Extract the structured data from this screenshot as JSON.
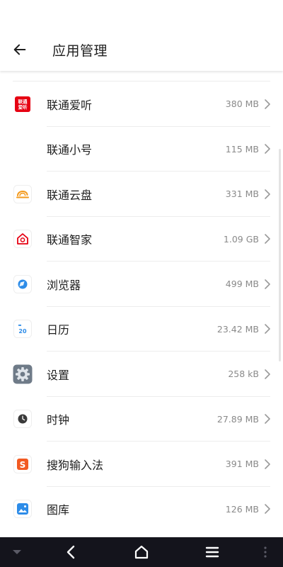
{
  "header": {
    "title": "应用管理"
  },
  "apps": [
    {
      "name": "联通爱听",
      "size": "380 MB",
      "icon": "unicom-aiting-icon"
    },
    {
      "name": "联通小号",
      "size": "115 MB",
      "icon": "none"
    },
    {
      "name": "联通云盘",
      "size": "331 MB",
      "icon": "unicom-cloud-icon"
    },
    {
      "name": "联通智家",
      "size": "1.09 GB",
      "icon": "unicom-smarthome-icon"
    },
    {
      "name": "浏览器",
      "size": "499 MB",
      "icon": "browser-icon"
    },
    {
      "name": "日历",
      "size": "23.42 MB",
      "icon": "calendar-icon"
    },
    {
      "name": "设置",
      "size": "258 kB",
      "icon": "settings-gear-icon"
    },
    {
      "name": "时钟",
      "size": "27.89 MB",
      "icon": "clock-icon"
    },
    {
      "name": "搜狗输入法",
      "size": "391 MB",
      "icon": "sogou-input-icon"
    },
    {
      "name": "图库",
      "size": "126 MB",
      "icon": "gallery-icon"
    }
  ],
  "icon_text": {
    "aiting": "联通\n爱听",
    "calendar_day": "20",
    "sogou": "S"
  },
  "colors": {
    "unicom_red": "#e60012",
    "cloud_orange": "#f39a1e",
    "browser_blue": "#2d8ce8",
    "sogou_orange": "#f25a22",
    "nav_bar": "#14141c"
  }
}
